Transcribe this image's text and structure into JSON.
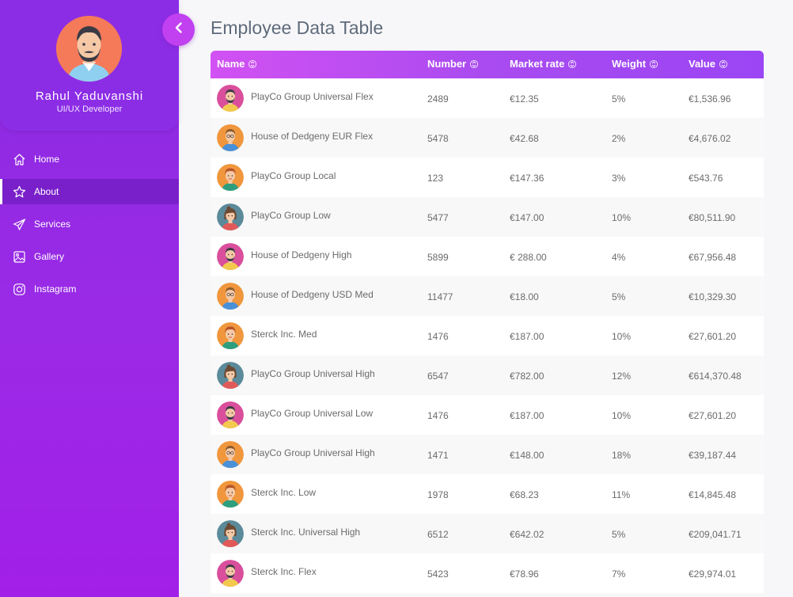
{
  "profile": {
    "name": "Rahul Yaduvanshi",
    "role": "UI/UX Developer"
  },
  "nav": {
    "items": [
      {
        "label": "Home",
        "icon": "home-icon",
        "active": false
      },
      {
        "label": "About",
        "icon": "star-icon",
        "active": true
      },
      {
        "label": "Services",
        "icon": "paper-plane-icon",
        "active": false
      },
      {
        "label": "Gallery",
        "icon": "image-icon",
        "active": false
      },
      {
        "label": "Instagram",
        "icon": "instagram-icon",
        "active": false
      }
    ]
  },
  "page": {
    "title": "Employee Data Table"
  },
  "table": {
    "headers": {
      "name": "Name",
      "number": "Number",
      "market_rate": "Market rate",
      "weight": "Weight",
      "value": "Value"
    },
    "rows": [
      {
        "name": "PlayCo Group Universal Flex",
        "number": "2489",
        "market_rate": "€12.35",
        "weight": "5%",
        "value": "€1,536.96",
        "avatar": "pink"
      },
      {
        "name": "House of Dedgeny EUR Flex",
        "number": "5478",
        "market_rate": "€42.68",
        "weight": "2%",
        "value": "€4,676.02",
        "avatar": "orange-glasses"
      },
      {
        "name": "PlayCo Group Local",
        "number": "123",
        "market_rate": "€147.36",
        "weight": "3%",
        "value": "€543.76",
        "avatar": "orange-green"
      },
      {
        "name": "PlayCo Group Low",
        "number": "5477",
        "market_rate": "€147.00",
        "weight": "10%",
        "value": "€80,511.90",
        "avatar": "teal-woman"
      },
      {
        "name": "House of Dedgeny High",
        "number": "5899",
        "market_rate": "€ 288.00",
        "weight": "4%",
        "value": "€67,956.48",
        "avatar": "pink"
      },
      {
        "name": "House of Dedgeny USD Med",
        "number": "11477",
        "market_rate": "€18.00",
        "weight": "5%",
        "value": "€10,329.30",
        "avatar": "orange-glasses"
      },
      {
        "name": "Sterck Inc. Med",
        "number": "1476",
        "market_rate": "€187.00",
        "weight": "10%",
        "value": "€27,601.20",
        "avatar": "orange-green"
      },
      {
        "name": "PlayCo Group Universal High",
        "number": "6547",
        "market_rate": "€782.00",
        "weight": "12%",
        "value": "€614,370.48",
        "avatar": "teal-woman"
      },
      {
        "name": "PlayCo Group Universal Low",
        "number": "1476",
        "market_rate": "€187.00",
        "weight": "10%",
        "value": "€27,601.20",
        "avatar": "pink"
      },
      {
        "name": "PlayCo Group Universal High",
        "number": "1471",
        "market_rate": "€148.00",
        "weight": "18%",
        "value": "€39,187.44",
        "avatar": "orange-glasses"
      },
      {
        "name": "Sterck Inc. Low",
        "number": "1978",
        "market_rate": "€68.23",
        "weight": "11%",
        "value": "€14,845.48",
        "avatar": "orange-green"
      },
      {
        "name": "Sterck Inc. Universal High",
        "number": "6512",
        "market_rate": "€642.02",
        "weight": "5%",
        "value": "€209,041.71",
        "avatar": "teal-woman"
      },
      {
        "name": "Sterck Inc. Flex",
        "number": "5423",
        "market_rate": "€78.96",
        "weight": "7%",
        "value": "€29,974.01",
        "avatar": "pink"
      }
    ]
  },
  "colors": {
    "sidebar": "#8a2be2",
    "header_gradient_start": "#d251f3",
    "header_gradient_end": "#9b45f4",
    "back_button": "#c140f0",
    "profile_avatar_bg": "#f47a5a"
  }
}
